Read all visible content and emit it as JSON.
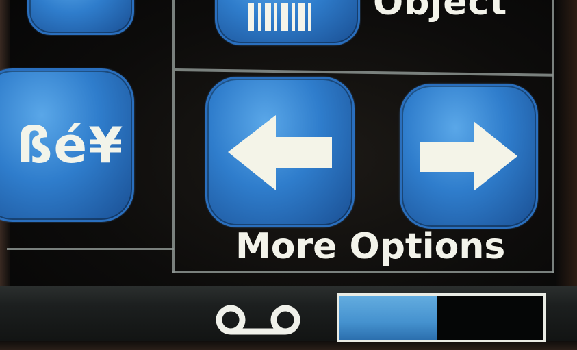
{
  "screen": {
    "top_right_label": "Object",
    "characters_button": {
      "text": "ßé¥"
    },
    "more_options": {
      "label": "More Options",
      "prev_icon": "arrow-left-icon",
      "next_icon": "arrow-right-icon"
    },
    "status": {
      "voicemail_icon": "voicemail-icon",
      "battery_level": 0.48
    }
  },
  "colors": {
    "button_blue": "#2f7dcc",
    "text": "#f3f3ea",
    "battery_fill": "#4592cf"
  }
}
